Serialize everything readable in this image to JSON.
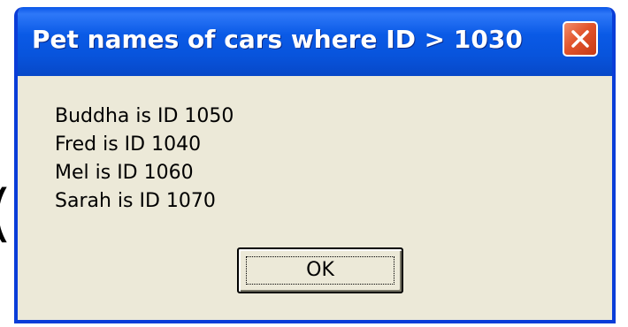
{
  "background_glyph": "(",
  "dialog": {
    "title": "Pet names of cars where ID > 1030",
    "close_icon": "close-icon",
    "messages": [
      "Buddha is ID 1050",
      "Fred is ID 1040",
      "Mel is ID 1060",
      "Sarah is ID 1070"
    ],
    "ok_label": "OK"
  },
  "colors": {
    "titlebar": "#0a5ae6",
    "frame_border": "#0a3dd8",
    "dialog_background": "#ece9d8",
    "close_button": "#e2542c"
  }
}
